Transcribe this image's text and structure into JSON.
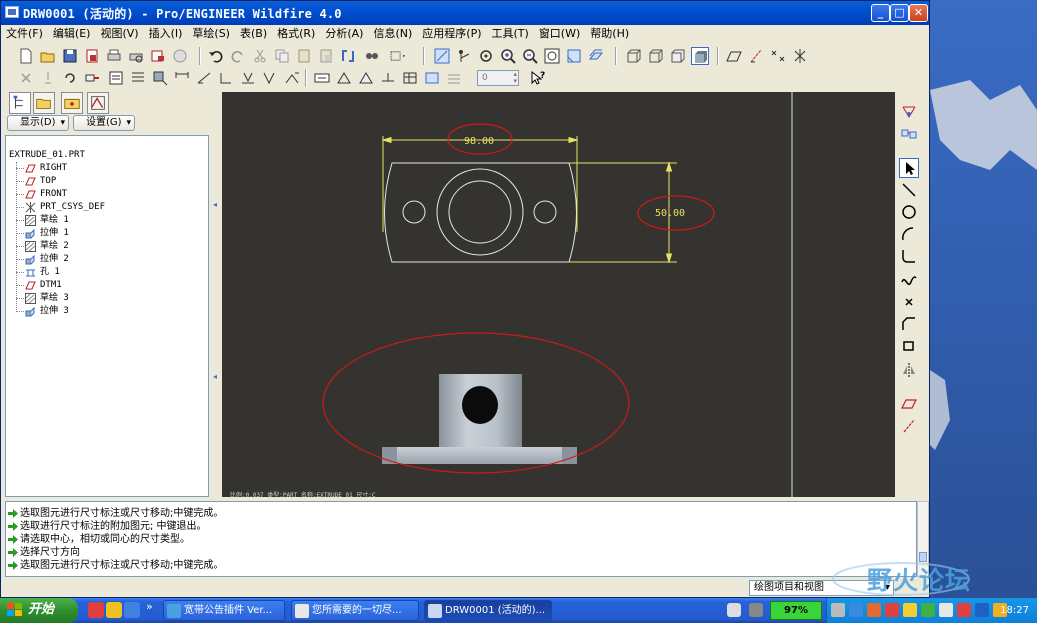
{
  "window": {
    "title": "DRW0001 (活动的) - Pro/ENGINEER Wildfire 4.0",
    "controls": {
      "minimize": "_",
      "maximize": "□",
      "close": "✕"
    }
  },
  "menu": [
    "文件(F)",
    "编辑(E)",
    "视图(V)",
    "插入(I)",
    "草绘(S)",
    "表(B)",
    "格式(R)",
    "分析(A)",
    "信息(N)",
    "应用程序(P)",
    "工具(T)",
    "窗口(W)",
    "帮助(H)"
  ],
  "toolbar2": {
    "spinner_value": "0"
  },
  "nav": {
    "display_label": "显示(D)",
    "settings_label": "设置(G)"
  },
  "tree": {
    "root": "EXTRUDE_01.PRT",
    "items": [
      {
        "label": "RIGHT",
        "icon": "datum-plane-icon"
      },
      {
        "label": "TOP",
        "icon": "datum-plane-icon"
      },
      {
        "label": "FRONT",
        "icon": "datum-plane-icon"
      },
      {
        "label": "PRT_CSYS_DEF",
        "icon": "csys-icon"
      },
      {
        "label": "草绘 1",
        "icon": "sketch-icon"
      },
      {
        "label": "拉伸 1",
        "icon": "extrude-icon"
      },
      {
        "label": "草绘 2",
        "icon": "sketch-icon"
      },
      {
        "label": "拉伸 2",
        "icon": "extrude-icon"
      },
      {
        "label": "孔 1",
        "icon": "hole-icon"
      },
      {
        "label": "DTM1",
        "icon": "datum-plane-icon"
      },
      {
        "label": "草绘 3",
        "icon": "sketch-icon"
      },
      {
        "label": "拉伸 3",
        "icon": "extrude-icon"
      }
    ]
  },
  "drawing": {
    "dim_width": "98.00",
    "dim_height": "50.00",
    "status_line": "比例:0.037    类型:PART    名称:EXTRUDE_01    尺寸:C"
  },
  "messages": [
    "选取图元进行尺寸标注或尺寸移动;中键完成。",
    "选取进行尺寸标注的附加图元; 中键退出。",
    "请选取中心，相切或同心的尺寸类型。",
    "选择尺寸方向",
    "选取图元进行尺寸标注或尺寸移动;中键完成。"
  ],
  "status": {
    "filter_value": "绘图项目和视图"
  },
  "watermark": "野火论坛",
  "taskbar": {
    "start_label": "开始",
    "tasks": [
      "宽带公告插件 Ver...",
      "您所需要的一切尽...",
      "DRW0001 (活动的)..."
    ],
    "battery": "97%",
    "clock": "18:27"
  },
  "colors": {
    "dimension": "#e8e060",
    "callout": "#d01818",
    "canvas": "#343330",
    "titlebar": "#0a5fd8"
  }
}
